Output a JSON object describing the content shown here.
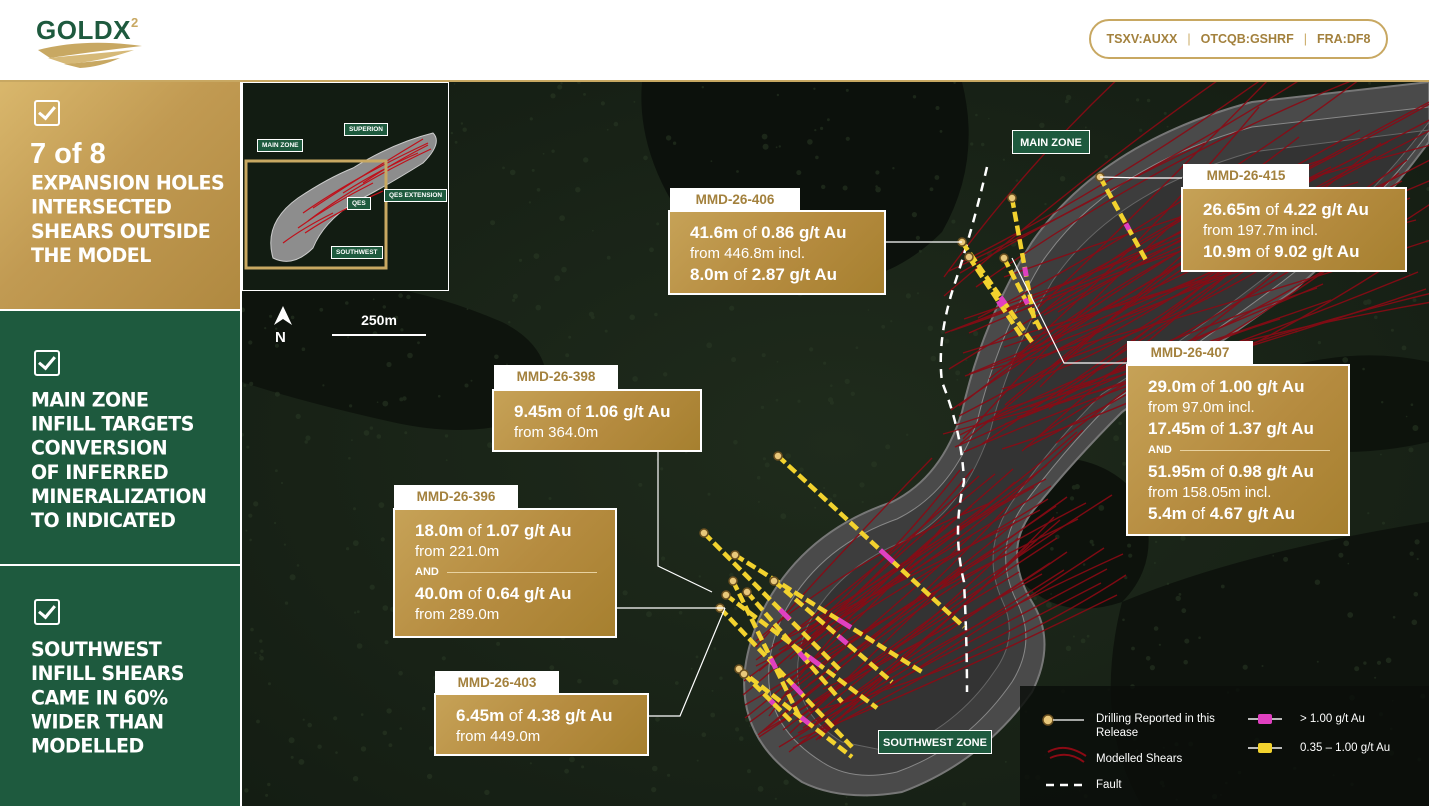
{
  "header": {
    "logo_text": "GOLDX",
    "logo_sup": "2",
    "tickers": [
      "TSXV:AUXX",
      "OTCQB:GSHRF",
      "FRA:DF8"
    ]
  },
  "sidebar": {
    "box1": {
      "stat": "7 of 8",
      "text": [
        "EXPANSION HOLES",
        "INTERSECTED",
        "SHEARS OUTSIDE",
        "THE MODEL"
      ]
    },
    "box2": {
      "text": [
        "MAIN ZONE",
        "INFILL TARGETS",
        "CONVERSION",
        "OF INFERRED",
        "MINERALIZATION",
        "TO INDICATED"
      ]
    },
    "box3": {
      "text": [
        "SOUTHWEST",
        "INFILL SHEARS",
        "CAME IN 60%",
        "WIDER THAN",
        "MODELLED"
      ]
    }
  },
  "inset": {
    "tags": {
      "main_zone": "MAIN ZONE",
      "superior": "SUPERION",
      "qes": "QES",
      "qes_extension": "QES EXTENSION",
      "southwest": "SOUTHWEST"
    }
  },
  "north_label": "N",
  "scale_label": "250m",
  "zones": {
    "main": "MAIN ZONE",
    "southwest": "SOUTHWEST ZONE"
  },
  "callouts": {
    "h406": {
      "label": "MMD-26-406",
      "lines": [
        {
          "b1": "41.6m",
          "t1": " of ",
          "b2": "0.86 g/t Au"
        },
        {
          "sub": "from 446.8m incl."
        },
        {
          "b1": "8.0m",
          "t1": " of ",
          "b2": "2.87 g/t Au"
        }
      ]
    },
    "h415": {
      "label": "MMD-26-415",
      "lines": [
        {
          "b1": "26.65m",
          "t1": " of ",
          "b2": "4.22 g/t Au"
        },
        {
          "sub": "from 197.7m incl."
        },
        {
          "b1": "10.9m",
          "t1": " of ",
          "b2": "9.02 g/t Au"
        }
      ]
    },
    "h407": {
      "label": "MMD-26-407",
      "lines_a": [
        {
          "b1": "29.0m",
          "t1": " of ",
          "b2": "1.00 g/t Au"
        },
        {
          "sub": "from 97.0m incl."
        },
        {
          "b1": "17.45m",
          "t1": " of ",
          "b2": "1.37 g/t Au"
        }
      ],
      "and": "AND",
      "lines_b": [
        {
          "b1": "51.95m",
          "t1": " of ",
          "b2": "0.98 g/t Au"
        },
        {
          "sub": "from 158.05m incl."
        },
        {
          "b1": "5.4m",
          "t1": " of ",
          "b2": "4.67 g/t Au"
        }
      ]
    },
    "h398": {
      "label": "MMD-26-398",
      "lines": [
        {
          "b1": "9.45m",
          "t1": " of ",
          "b2": "1.06 g/t Au"
        },
        {
          "sub": "from 364.0m"
        }
      ]
    },
    "h396": {
      "label": "MMD-26-396",
      "lines_a": [
        {
          "b1": "18.0m",
          "t1": " of ",
          "b2": "1.07 g/t Au"
        },
        {
          "sub": "from 221.0m"
        }
      ],
      "and": "AND",
      "lines_b": [
        {
          "b1": "40.0m",
          "t1": " of ",
          "b2": "0.64 g/t Au"
        },
        {
          "sub": "from 289.0m"
        }
      ]
    },
    "h403": {
      "label": "MMD-26-403",
      "lines": [
        {
          "b1": "6.45m",
          "t1": " of ",
          "b2": "4.38 g/t Au"
        },
        {
          "sub": "from 449.0m"
        }
      ]
    }
  },
  "legend": {
    "drilling": "Drilling Reported in this Release",
    "shears": "Modelled Shears",
    "fault": "Fault",
    "high": "> 1.00 g/t Au",
    "mid": "0.35 – 1.00 g/t Au"
  },
  "colors": {
    "gold": "#c19a52",
    "green": "#1e5a3e",
    "high_grade": "#e040c0",
    "mid_grade": "#f2d22e",
    "shear": "#8b0a14"
  }
}
